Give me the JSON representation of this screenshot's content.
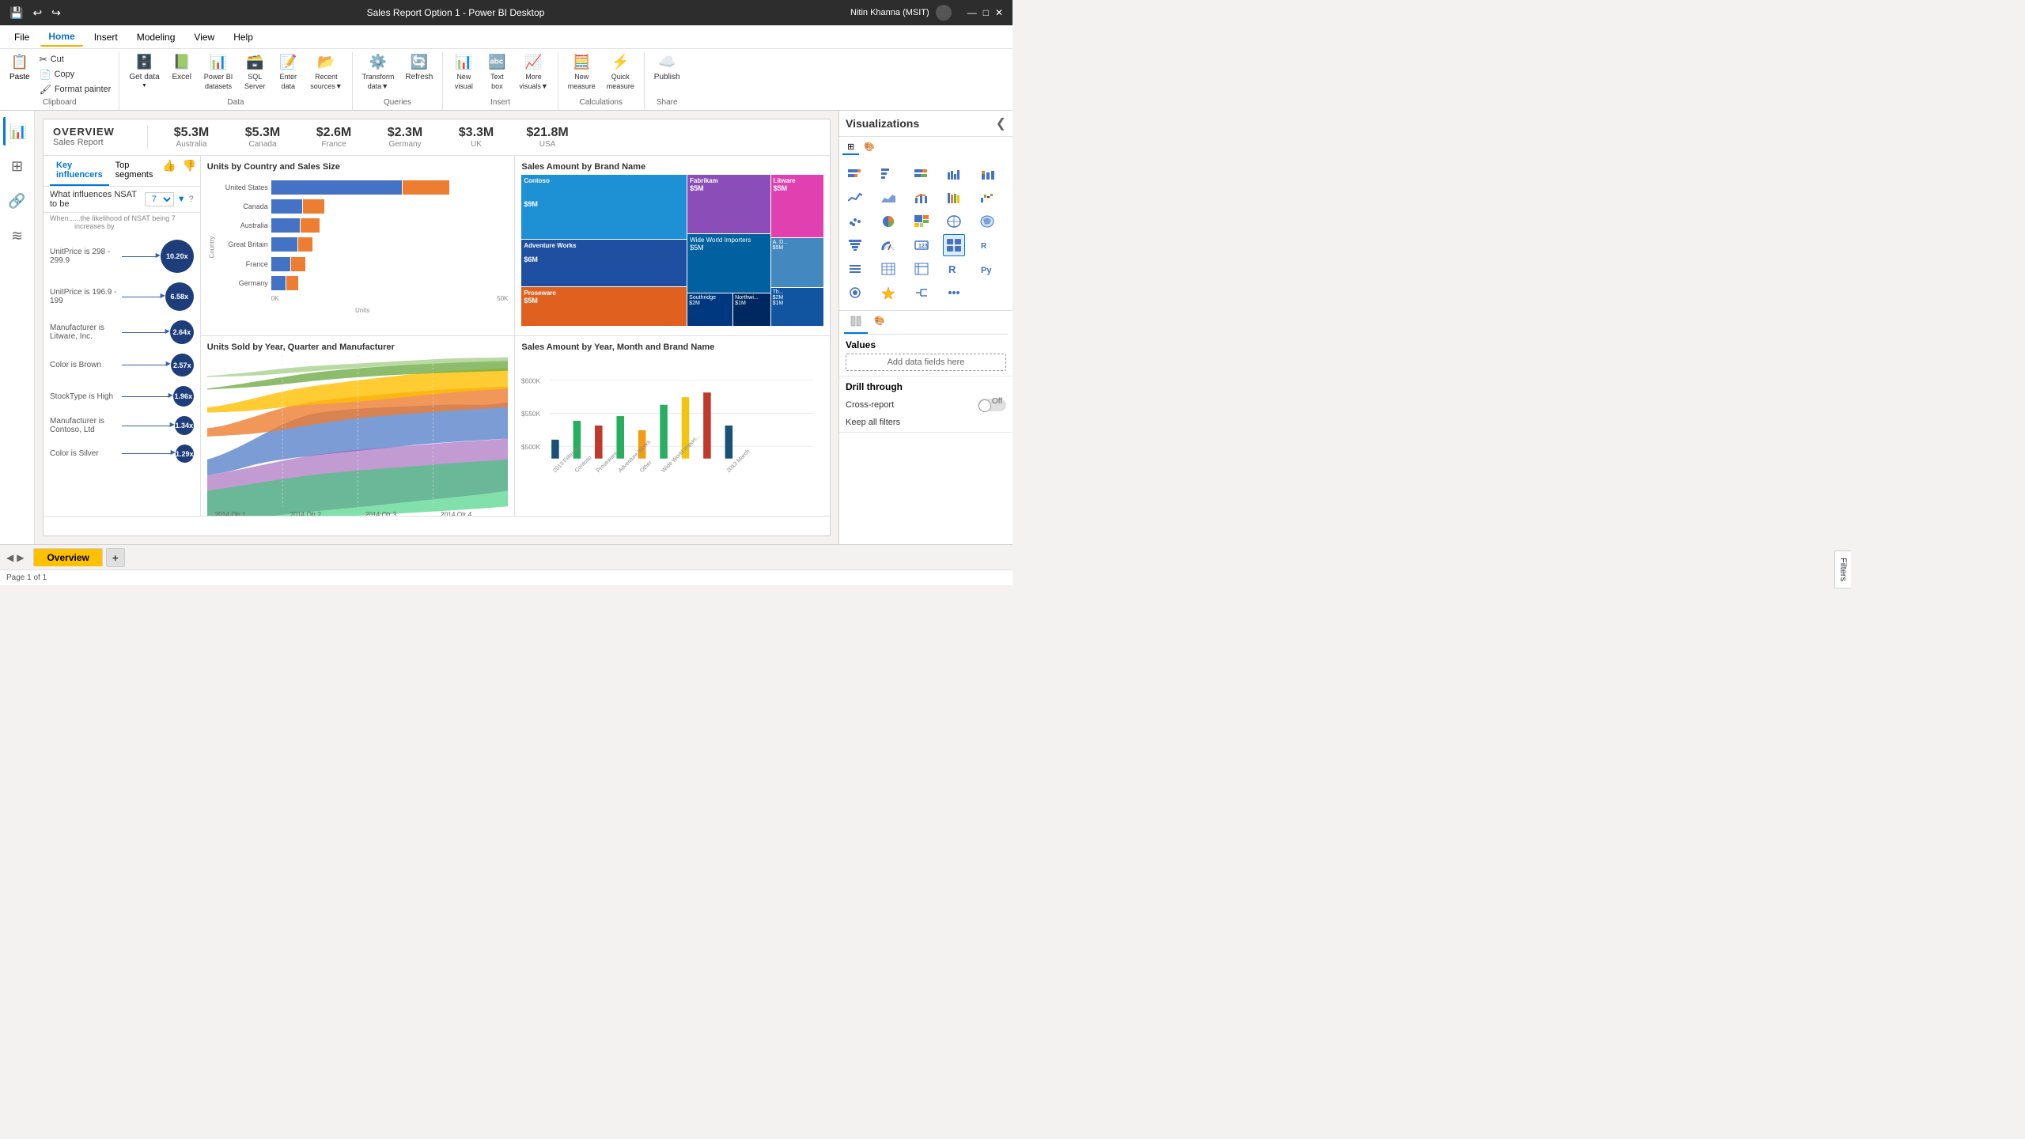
{
  "titleBar": {
    "title": "Sales Report Option 1 - Power BI Desktop",
    "user": "Nitin Khanna (MSIT)",
    "minBtn": "—",
    "maxBtn": "□",
    "closeBtn": "✕"
  },
  "menuBar": {
    "items": [
      {
        "id": "file",
        "label": "File"
      },
      {
        "id": "home",
        "label": "Home",
        "active": true
      },
      {
        "id": "insert",
        "label": "Insert"
      },
      {
        "id": "modeling",
        "label": "Modeling"
      },
      {
        "id": "view",
        "label": "View"
      },
      {
        "id": "help",
        "label": "Help"
      }
    ]
  },
  "ribbon": {
    "sections": [
      {
        "id": "clipboard",
        "label": "Clipboard",
        "items": [
          "Paste",
          "Cut",
          "Copy",
          "Format painter"
        ]
      },
      {
        "id": "data",
        "label": "Data",
        "items": [
          "Get data",
          "Excel",
          "Power BI datasets",
          "SQL Server",
          "Enter data",
          "Recent sources"
        ]
      },
      {
        "id": "queries",
        "label": "Queries",
        "items": [
          "Transform data",
          "Refresh"
        ]
      },
      {
        "id": "insert",
        "label": "Insert",
        "items": [
          "New visual",
          "Text box",
          "More visuals"
        ]
      },
      {
        "id": "calculations",
        "label": "Calculations",
        "items": [
          "New measure",
          "Quick measure"
        ]
      },
      {
        "id": "share",
        "label": "Share",
        "items": [
          "Publish"
        ]
      }
    ],
    "buttons": {
      "paste": "Paste",
      "cut": "Cut",
      "copy": "Copy",
      "formatPainter": "Format painter",
      "getData": "Get data",
      "excel": "Excel",
      "powerBIDatasets": "Power BI datasets",
      "sqlServer": "SQL Server",
      "enterData": "Enter data",
      "recentSources": "Recent sources",
      "transformData": "Transform data",
      "refresh": "Refresh",
      "newVisual": "New visual",
      "textBox": "Text box",
      "moreVisuals": "More visuals",
      "newMeasure": "New measure",
      "quickMeasure": "Quick measure",
      "publish": "Publish"
    }
  },
  "overview": {
    "title": "OVERVIEW",
    "subtitle": "Sales Report",
    "kpis": [
      {
        "value": "$5.3M",
        "label": "Australia"
      },
      {
        "value": "$5.3M",
        "label": "Canada"
      },
      {
        "value": "$2.6M",
        "label": "France"
      },
      {
        "value": "$2.3M",
        "label": "Germany"
      },
      {
        "value": "$3.3M",
        "label": "UK"
      },
      {
        "value": "$21.8M",
        "label": "USA"
      }
    ]
  },
  "keyInfluencers": {
    "title": "Key influencers",
    "tabs": [
      "Key influencers",
      "Top segments"
    ],
    "question": "What influences NSAT to be",
    "questionValue": "7",
    "columnHeaders": [
      "When...",
      "...the likelihood of NSAT being 7 increases by"
    ],
    "rows": [
      {
        "label": "UnitPrice is 298 - 299.9",
        "value": "10.20x",
        "size": 38
      },
      {
        "label": "UnitPrice is 196.9 - 199",
        "value": "6.58x",
        "size": 32
      },
      {
        "label": "Manufacturer is Litware, Inc.",
        "value": "2.64x",
        "size": 26
      },
      {
        "label": "Color is Brown",
        "value": "2.57x",
        "size": 25
      },
      {
        "label": "StockType is High",
        "value": "1.96x",
        "size": 22
      },
      {
        "label": "Manufacturer is Contoso, Ltd",
        "value": "1.34x",
        "size": 20
      },
      {
        "label": "Color is Silver",
        "value": "1.29x",
        "size": 19
      }
    ]
  },
  "barChart": {
    "title": "Units by Country and Sales Size",
    "countries": [
      "United States",
      "Canada",
      "Australia",
      "Great Britain",
      "France",
      "Germany"
    ],
    "xLabels": [
      "0K",
      "50K"
    ],
    "xLabel": "Units",
    "yLabel": "Country",
    "bars": [
      {
        "country": "United States",
        "blue": 72,
        "orange": 28
      },
      {
        "country": "Canada",
        "blue": 18,
        "orange": 12
      },
      {
        "country": "Australia",
        "blue": 16,
        "orange": 10
      },
      {
        "country": "Great Britain",
        "blue": 15,
        "orange": 8
      },
      {
        "country": "France",
        "blue": 10,
        "orange": 8
      },
      {
        "country": "Germany",
        "blue": 8,
        "orange": 7
      }
    ]
  },
  "treemap": {
    "title": "Sales Amount by Brand Name",
    "cells": [
      {
        "label": "Contoso",
        "value": "$9M",
        "color": "#1e90d4",
        "size": "large"
      },
      {
        "label": "Fabrikam",
        "value": "$5M",
        "color": "#8b4db8",
        "size": "medium"
      },
      {
        "label": "Litware",
        "value": "$5M",
        "color": "#e040b0",
        "size": "medium"
      },
      {
        "label": "Adventure Works",
        "value": "$6M",
        "color": "#1e4fa0",
        "size": "large2"
      },
      {
        "label": "Wide World Importers",
        "value": "$5M",
        "color": "#0060a0",
        "size": "medium2"
      },
      {
        "label": "A. D...",
        "value": "",
        "color": "#4488c0",
        "size": "small"
      },
      {
        "label": "Th...",
        "value": "",
        "color": "#5588b0",
        "size": "small"
      },
      {
        "label": "Proseware",
        "value": "$5M",
        "color": "#e06020",
        "size": "medium3"
      },
      {
        "label": "Southridge Video",
        "value": "$2M",
        "color": "#0050a0",
        "size": "small2"
      },
      {
        "label": "Northwi...",
        "value": "$1M",
        "color": "#003880",
        "size": "small3"
      }
    ]
  },
  "streamChart": {
    "title": "Units Sold by Year, Quarter and Manufacturer",
    "xLabels": [
      "2014 Qtr 1",
      "2014 Qtr 2",
      "2014 Qtr 3",
      "2014 Qtr 4"
    ]
  },
  "columnChart": {
    "title": "Sales Amount by Year, Month and Brand Name",
    "yLabels": [
      "$600K",
      "$550K",
      "$500K"
    ],
    "xLabels": [
      "2013 February",
      "Contoso",
      "Proseware",
      "Adventure Works",
      "Other",
      "Wide World Import...",
      "2013 March"
    ]
  },
  "visualizations": {
    "title": "Visualizations",
    "icons": [
      "📊",
      "📈",
      "📉",
      "🗃️",
      "📋",
      "📊",
      "🔢",
      "📈",
      "📊",
      "📋",
      "📊",
      "🔲",
      "⬜",
      "🕐",
      "📋",
      "🔮",
      "⭐",
      "🌊",
      "🔢",
      "📝",
      "📊",
      "📊",
      "📈",
      "🅁",
      "🅐",
      "📍",
      "💬",
      "📍",
      "🔷",
      "⬡",
      "🖼️",
      "◆",
      "🌀",
      "🥧",
      "🔵",
      "📊"
    ],
    "valuesTitle": "Values",
    "addFieldsPlaceholder": "Add data fields here",
    "drillThrough": "Drill through",
    "crossReport": "Cross-report",
    "crossReportToggle": "Off",
    "keepAllFilters": "Keep all filters"
  },
  "pageTabs": {
    "tabs": [
      "Overview"
    ],
    "addButton": "+",
    "pageInfo": "Page 1 of 1"
  }
}
